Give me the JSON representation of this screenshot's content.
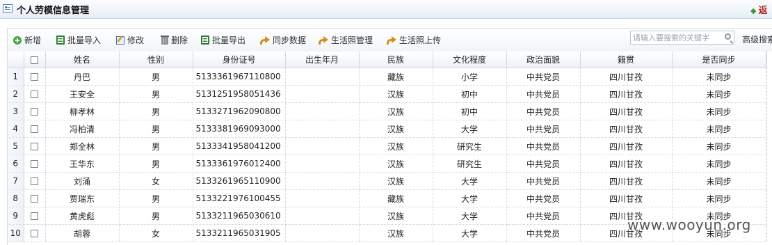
{
  "window": {
    "title": "个人劳模信息管理",
    "back_label": "返"
  },
  "toolbar": {
    "buttons": [
      {
        "label": "新增",
        "icon": "add-icon"
      },
      {
        "label": "批量导入",
        "icon": "excel-import-icon"
      },
      {
        "label": "修改",
        "icon": "edit-icon"
      },
      {
        "label": "删除",
        "icon": "trash-icon"
      },
      {
        "label": "批量导出",
        "icon": "excel-export-icon"
      },
      {
        "label": "同步数据",
        "icon": "sync-icon"
      },
      {
        "label": "生活照管理",
        "icon": "sync-icon"
      },
      {
        "label": "生活照上传",
        "icon": "sync-icon"
      }
    ],
    "search_placeholder": "请输入要搜索的关键字",
    "advanced_search_label": "高级搜索"
  },
  "table": {
    "columns": [
      "姓名",
      "性别",
      "身份证号",
      "出生年月",
      "民族",
      "文化程度",
      "政治面貌",
      "籍贯",
      "是否同步"
    ],
    "rows": [
      {
        "num": "1",
        "name": "丹巴",
        "gender": "男",
        "id": "5133361967110800",
        "birth": "",
        "ethnicity": "藏族",
        "education": "小学",
        "politics": "中共党员",
        "hometown": "四川甘孜",
        "synced": "未同步"
      },
      {
        "num": "2",
        "name": "王安全",
        "gender": "男",
        "id": "5131251958051436",
        "birth": "",
        "ethnicity": "汉族",
        "education": "初中",
        "politics": "中共党员",
        "hometown": "四川甘孜",
        "synced": "未同步"
      },
      {
        "num": "3",
        "name": "柳孝林",
        "gender": "男",
        "id": "5133271962090800",
        "birth": "",
        "ethnicity": "汉族",
        "education": "初中",
        "politics": "中共党员",
        "hometown": "四川甘孜",
        "synced": "未同步"
      },
      {
        "num": "4",
        "name": "冯柏清",
        "gender": "男",
        "id": "5133381969093000",
        "birth": "",
        "ethnicity": "汉族",
        "education": "大学",
        "politics": "中共党员",
        "hometown": "四川甘孜",
        "synced": "未同步"
      },
      {
        "num": "5",
        "name": "郑全林",
        "gender": "男",
        "id": "5133341958041200",
        "birth": "",
        "ethnicity": "汉族",
        "education": "研究生",
        "politics": "中共党员",
        "hometown": "四川甘孜",
        "synced": "未同步"
      },
      {
        "num": "6",
        "name": "王华东",
        "gender": "男",
        "id": "5133361976012400",
        "birth": "",
        "ethnicity": "汉族",
        "education": "研究生",
        "politics": "中共党员",
        "hometown": "四川甘孜",
        "synced": "未同步"
      },
      {
        "num": "7",
        "name": "刘涌",
        "gender": "女",
        "id": "5133261965110900",
        "birth": "",
        "ethnicity": "汉族",
        "education": "大学",
        "politics": "中共党员",
        "hometown": "四川甘孜",
        "synced": "未同步"
      },
      {
        "num": "8",
        "name": "贾瑞东",
        "gender": "男",
        "id": "5133221976100455",
        "birth": "",
        "ethnicity": "藏族",
        "education": "大学",
        "politics": "中共党员",
        "hometown": "四川甘孜",
        "synced": "未同步"
      },
      {
        "num": "9",
        "name": "黄虎彪",
        "gender": "男",
        "id": "5133211965030610",
        "birth": "",
        "ethnicity": "汉族",
        "education": "大学",
        "politics": "中共党员",
        "hometown": "四川甘孜",
        "synced": "未同步"
      },
      {
        "num": "10",
        "name": "胡蓉",
        "gender": "女",
        "id": "5133211965031905",
        "birth": "",
        "ethnicity": "汉族",
        "education": "大学",
        "politics": "中共党员",
        "hometown": "四川甘孜",
        "synced": "未同步"
      }
    ]
  },
  "watermark": "www.wooyun.org",
  "colors": {
    "accent_blue": "#5b7fb5",
    "back_red": "#b3261e",
    "add_green": "#49a540",
    "excel_green": "#2f7d32",
    "sync_orange": "#d98a1c"
  }
}
